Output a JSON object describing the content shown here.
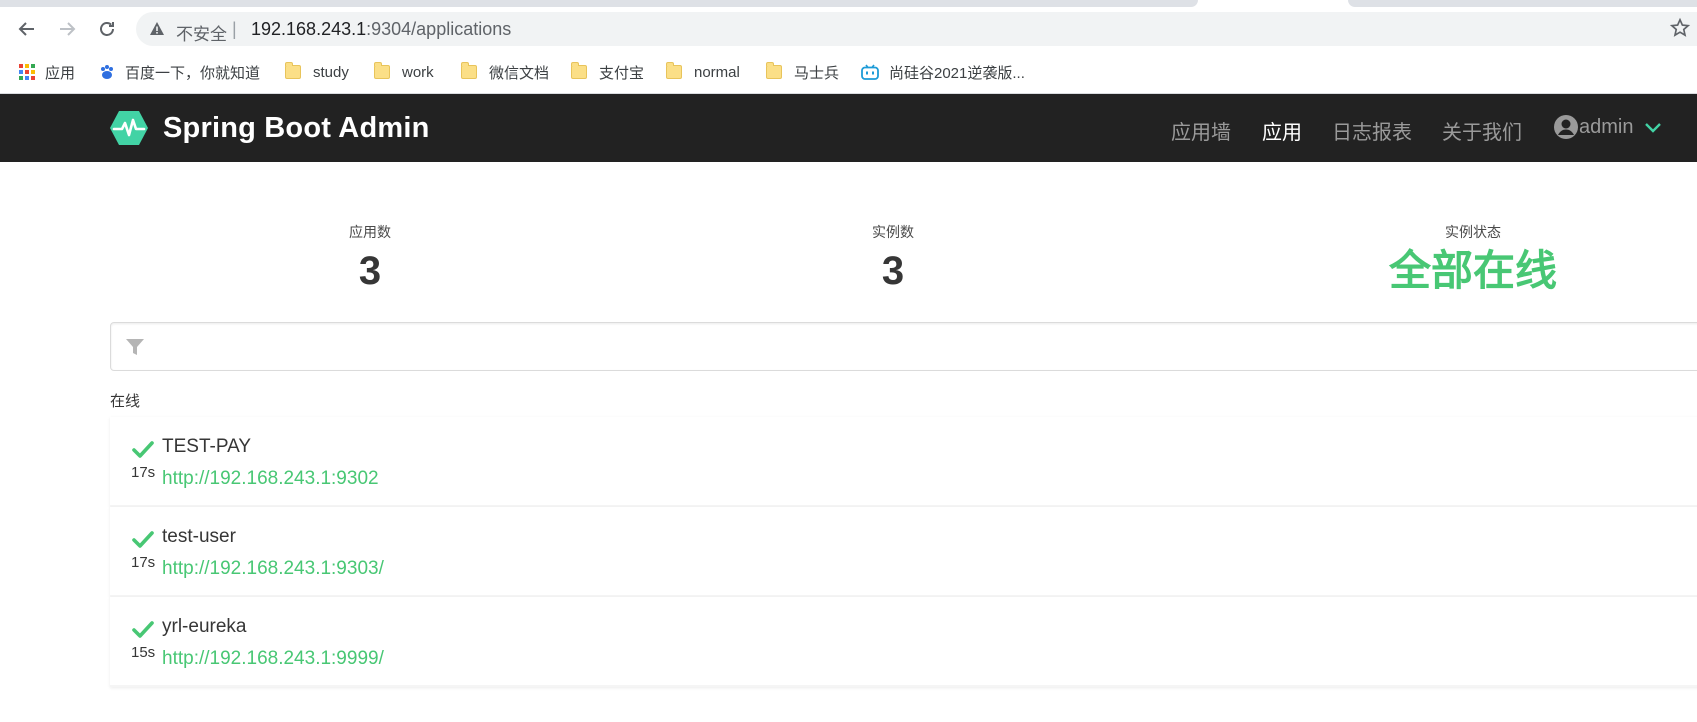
{
  "browser": {
    "insecure_label": "不安全",
    "separator": "|",
    "url_host": "192.168.243.1",
    "url_rest": ":9304/applications",
    "bookmarks": [
      {
        "label": "应用",
        "icon": "apps-grid-icon"
      },
      {
        "label": "百度一下，你就知道",
        "icon": "baidu-paw-icon"
      },
      {
        "label": "study",
        "icon": "folder-icon"
      },
      {
        "label": "work",
        "icon": "folder-icon"
      },
      {
        "label": "微信文档",
        "icon": "folder-icon"
      },
      {
        "label": "支付宝",
        "icon": "folder-icon"
      },
      {
        "label": "normal",
        "icon": "folder-icon"
      },
      {
        "label": "马士兵",
        "icon": "folder-icon"
      },
      {
        "label": "尚硅谷2021逆袭版...",
        "icon": "bilibili-icon"
      }
    ]
  },
  "navbar": {
    "brand": "Spring Boot Admin",
    "items": [
      {
        "label": "应用墙",
        "active": false
      },
      {
        "label": "应用",
        "active": true
      },
      {
        "label": "日志报表",
        "active": false
      },
      {
        "label": "关于我们",
        "active": false
      }
    ],
    "user": "admin"
  },
  "stats": {
    "applications_label": "应用数",
    "applications_value": "3",
    "instances_label": "实例数",
    "instances_value": "3",
    "status_label": "实例状态",
    "status_value": "全部在线"
  },
  "filter": {
    "placeholder": "",
    "value": ""
  },
  "section_label": "在线",
  "applications": [
    {
      "name": "TEST-PAY",
      "age": "17s",
      "url": "http://192.168.243.1:9302",
      "status": "UP"
    },
    {
      "name": "test-user",
      "age": "17s",
      "url": "http://192.168.243.1:9303/",
      "status": "UP"
    },
    {
      "name": "yrl-eureka",
      "age": "15s",
      "url": "http://192.168.243.1:9999/",
      "status": "UP"
    }
  ],
  "colors": {
    "accent": "#48c774",
    "navbar": "#222222"
  }
}
